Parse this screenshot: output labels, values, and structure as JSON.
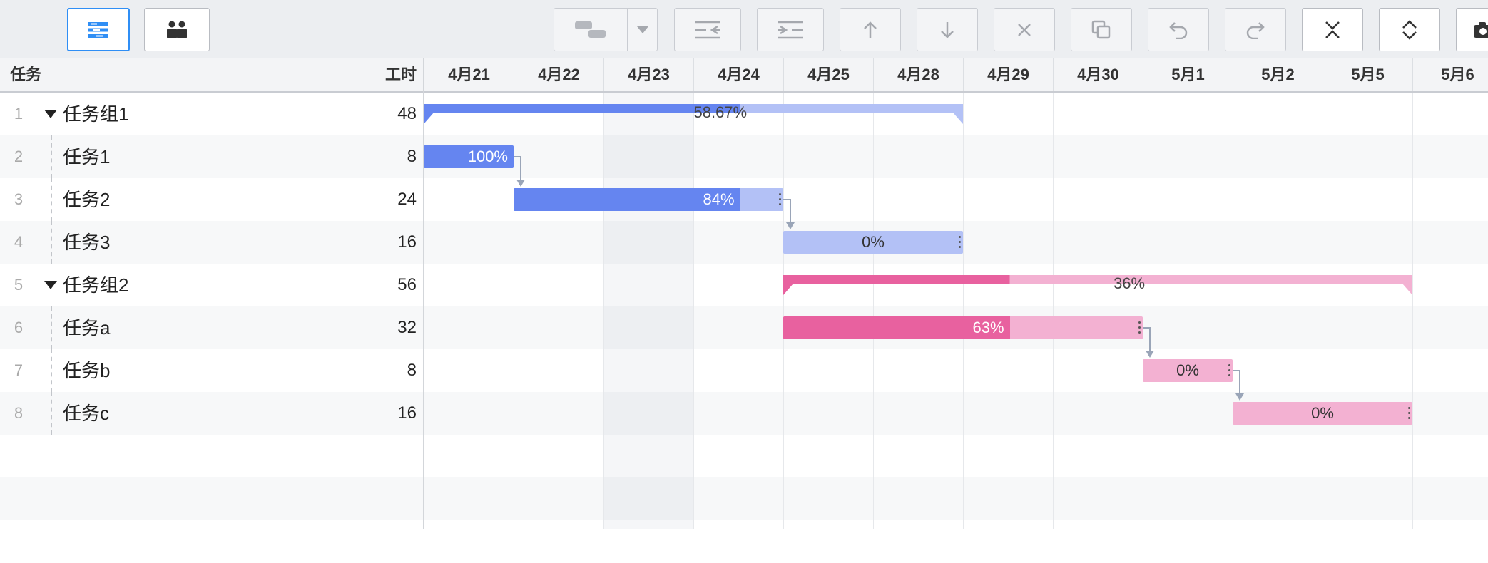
{
  "toolbar": {
    "buttons": [
      {
        "name": "view-list-button",
        "icon": "list-view-icon"
      },
      {
        "name": "people-view-button",
        "icon": "people-icon"
      },
      {
        "name": "link-type-button",
        "icon": "link-bars-icon"
      },
      {
        "name": "link-type-dropdown",
        "icon": "caret-down-icon"
      },
      {
        "name": "outdent-button",
        "icon": "outdent-icon"
      },
      {
        "name": "indent-button",
        "icon": "indent-icon"
      },
      {
        "name": "move-up-button",
        "icon": "arrow-up-icon"
      },
      {
        "name": "move-down-button",
        "icon": "arrow-down-icon"
      },
      {
        "name": "delete-button",
        "icon": "close-icon"
      },
      {
        "name": "copy-button",
        "icon": "copy-icon"
      },
      {
        "name": "undo-button",
        "icon": "undo-icon"
      },
      {
        "name": "redo-button",
        "icon": "redo-icon"
      },
      {
        "name": "collapse-all-button",
        "icon": "collapse-icon"
      },
      {
        "name": "expand-all-button",
        "icon": "expand-icon"
      },
      {
        "name": "screenshot-button",
        "icon": "camera-icon"
      }
    ]
  },
  "grid": {
    "task_header": "任务",
    "hours_header": "工时"
  },
  "dates": [
    "4月21",
    "4月22",
    "4月23",
    "4月24",
    "4月25",
    "4月28",
    "4月29",
    "4月30",
    "5月1",
    "5月2",
    "5月5",
    "5月6"
  ],
  "rows": [
    {
      "num": "1",
      "name": "任务组1",
      "hours": "48",
      "group": true
    },
    {
      "num": "2",
      "name": "任务1",
      "hours": "8",
      "group": false
    },
    {
      "num": "3",
      "name": "任务2",
      "hours": "24",
      "group": false
    },
    {
      "num": "4",
      "name": "任务3",
      "hours": "16",
      "group": false
    },
    {
      "num": "5",
      "name": "任务组2",
      "hours": "56",
      "group": true
    },
    {
      "num": "6",
      "name": "任务a",
      "hours": "32",
      "group": false
    },
    {
      "num": "7",
      "name": "任务b",
      "hours": "8",
      "group": false
    },
    {
      "num": "8",
      "name": "任务c",
      "hours": "16",
      "group": false
    }
  ],
  "bars": [
    {
      "row": 0,
      "type": "summary",
      "start": 0,
      "days": 6,
      "progress": 0.5867,
      "label": "58.67%"
    },
    {
      "row": 1,
      "type": "task",
      "start": 0,
      "days": 1,
      "progress": 1.0,
      "label": "100%"
    },
    {
      "row": 2,
      "type": "task",
      "start": 1,
      "days": 3,
      "progress": 0.84,
      "label": "84%"
    },
    {
      "row": 3,
      "type": "task",
      "start": 4,
      "days": 2,
      "progress": 0.0,
      "label": "0%"
    },
    {
      "row": 4,
      "type": "summary",
      "start": 4,
      "days": 7,
      "progress": 0.36,
      "label": "36%"
    },
    {
      "row": 5,
      "type": "task",
      "start": 4,
      "days": 4,
      "progress": 0.63,
      "label": "63%"
    },
    {
      "row": 6,
      "type": "task",
      "start": 8,
      "days": 1,
      "progress": 0.0,
      "label": "0%"
    },
    {
      "row": 7,
      "type": "task",
      "start": 9,
      "days": 2,
      "progress": 0.0,
      "label": "0%"
    }
  ],
  "links": [
    [
      1,
      2
    ],
    [
      2,
      3
    ],
    [
      5,
      6
    ],
    [
      6,
      7
    ]
  ],
  "colors": {
    "group1_dark": "#6585f0",
    "group1_light": "#b3c1f6",
    "group2_dark": "#e8619f",
    "group2_light": "#f3b1d2"
  }
}
